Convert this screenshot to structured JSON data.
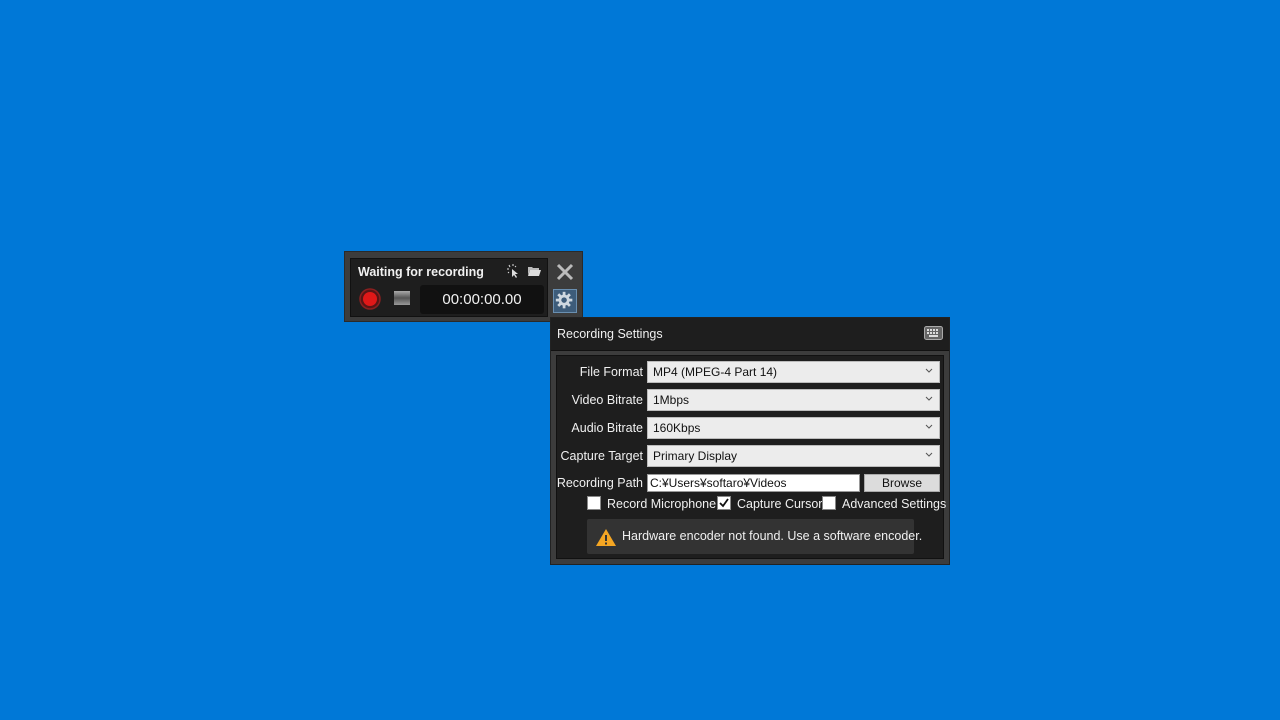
{
  "recorder": {
    "status": "Waiting for recording",
    "timer": "00:00:00.00",
    "icons": {
      "cursor": "cursor-click-icon",
      "folder": "folder-open-icon",
      "record": "record-icon",
      "stop": "stop-icon",
      "close": "close-icon",
      "settings": "gear-icon"
    }
  },
  "settings": {
    "title": "Recording Settings",
    "keyboard_icon": "keyboard-icon",
    "fields": [
      {
        "label": "File Format",
        "value": "MP4 (MPEG-4 Part 14)"
      },
      {
        "label": "Video Bitrate",
        "value": "1Mbps"
      },
      {
        "label": "Audio Bitrate",
        "value": "160Kbps"
      },
      {
        "label": "Capture Target",
        "value": "Primary Display"
      }
    ],
    "recording_path": {
      "label": "Recording Path",
      "value": "C:¥Users¥softaro¥Videos",
      "browse_label": "Browse"
    },
    "checkboxes": [
      {
        "label": "Record Microphone",
        "checked": false
      },
      {
        "label": "Capture Cursor",
        "checked": true
      },
      {
        "label": "Advanced Settings",
        "checked": false
      }
    ],
    "warning": {
      "icon": "warning-icon",
      "text": "Hardware encoder not found. Use a software encoder.",
      "color": "#f5a623"
    }
  }
}
